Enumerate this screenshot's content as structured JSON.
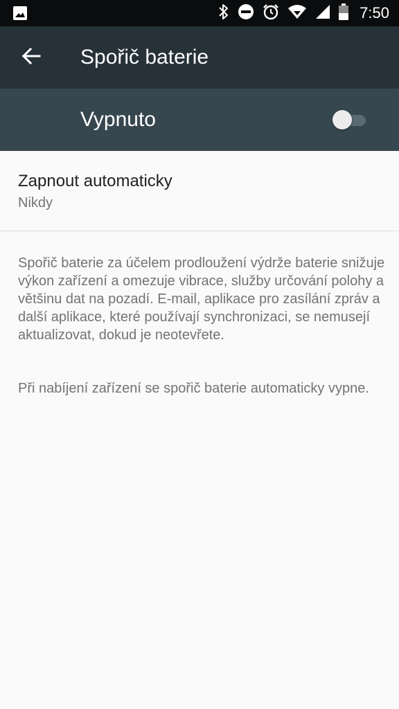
{
  "status_bar": {
    "time": "7:50",
    "icons": [
      "image-icon",
      "bluetooth-icon",
      "do-not-disturb-icon",
      "alarm-icon",
      "wifi-icon",
      "signal-icon",
      "battery-icon"
    ]
  },
  "app_bar": {
    "title": "Spořič baterie",
    "back_icon": "arrow-back-icon"
  },
  "master_switch": {
    "label": "Vypnuto",
    "checked": false
  },
  "preference": {
    "title": "Zapnout automaticky",
    "summary": "Nikdy"
  },
  "footer": {
    "paragraph1": "Spořič baterie za účelem prodloužení výdrže baterie snižuje výkon zařízení a omezuje vibrace, služby určování polohy a většinu dat na pozadí. E-mail, aplikace pro zasílání zpráv a další aplikace, které používají synchronizaci, se nemusejí aktualizovat, dokud je neotevřete.",
    "paragraph2": "Při nabíjení zařízení se spořič baterie automaticky vypne."
  },
  "colors": {
    "app_bar": "#263238",
    "switch_bar": "#37474f",
    "background": "#fafafa"
  }
}
